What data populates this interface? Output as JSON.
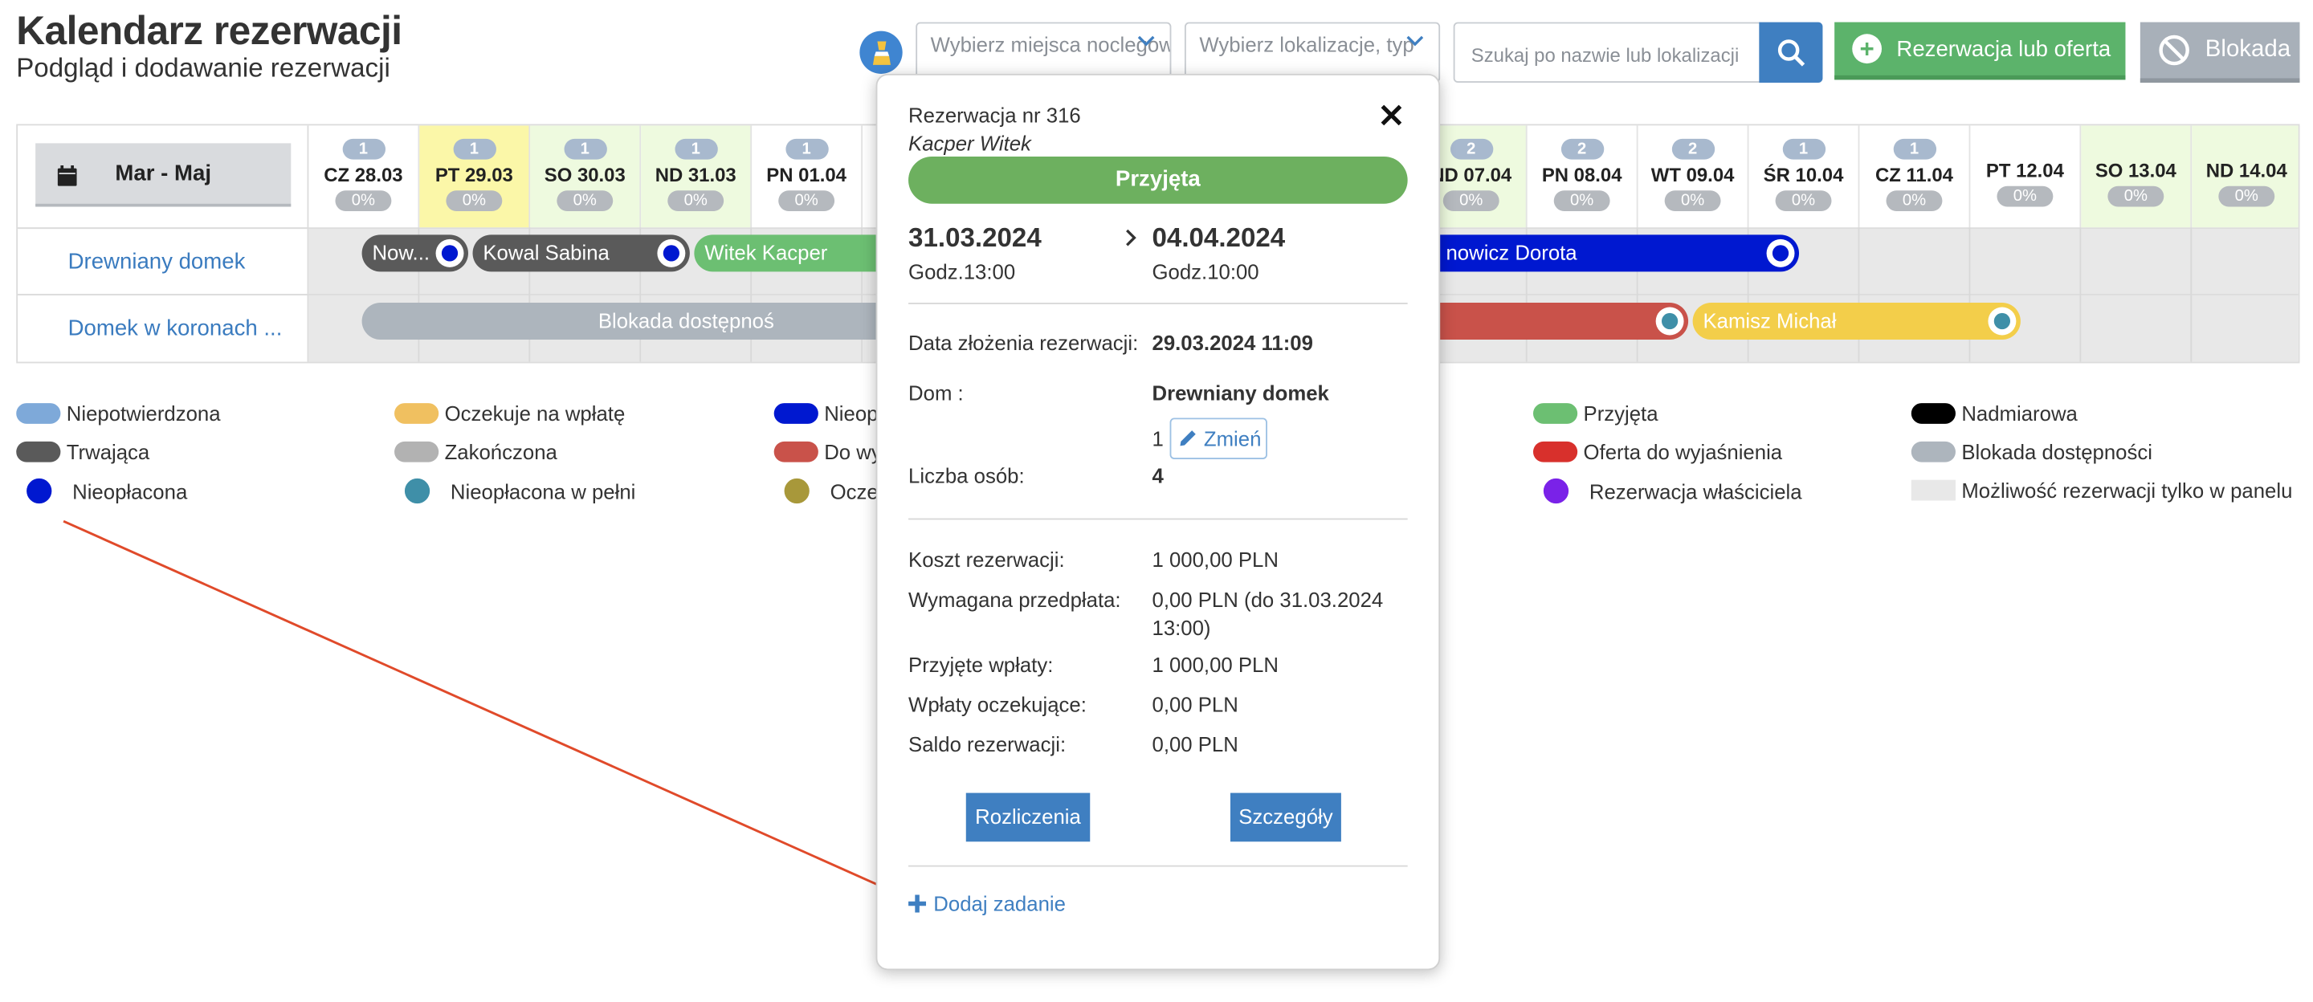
{
  "header": {
    "title": "Kalendarz rezerwacji",
    "subtitle": "Podgląd i dodawanie rezerwacji"
  },
  "toolbar": {
    "select_places_placeholder": "Wybierz miejsca noclegowe",
    "select_location_placeholder": "Wybierz lokalizacje, typ",
    "search_placeholder": "Szukaj po nazwie lub lokalizacji",
    "new_reservation_label": "Rezerwacja lub oferta",
    "block_label": "Blokada"
  },
  "calendar": {
    "range_label": "Mar - Maj",
    "days": [
      {
        "count": "1",
        "label": "CZ 28.03",
        "pct": "0%"
      },
      {
        "count": "1",
        "label": "PT 29.03",
        "pct": "0%",
        "bg": "#fbf7a8"
      },
      {
        "count": "1",
        "label": "SO 30.03",
        "pct": "0%",
        "bg": "#eefadf"
      },
      {
        "count": "1",
        "label": "ND 31.03",
        "pct": "0%",
        "bg": "#eefadf"
      },
      {
        "count": "1",
        "label": "PN 01.04",
        "pct": "0%"
      },
      {
        "count": "2",
        "label": "ND 07.04",
        "pct": "0%",
        "bg": "#eefadf"
      },
      {
        "count": "2",
        "label": "PN 08.04",
        "pct": "0%"
      },
      {
        "count": "2",
        "label": "WT 09.04",
        "pct": "0%"
      },
      {
        "count": "1",
        "label": "ŚR 10.04",
        "pct": "0%"
      },
      {
        "count": "1",
        "label": "CZ 11.04",
        "pct": "0%"
      },
      {
        "count": "",
        "label": "PT 12.04",
        "pct": "0%"
      },
      {
        "count": "",
        "label": "SO 13.04",
        "pct": "0%",
        "bg": "#eefadf"
      },
      {
        "count": "",
        "label": "ND 14.04",
        "pct": "0%",
        "bg": "#eefadf"
      }
    ],
    "rooms": [
      "Drewniany domek",
      "Domek w koronach ..."
    ],
    "bars": {
      "nowak": "Now...",
      "kowal": "Kowal Sabina",
      "witek": "Witek Kacper",
      "dorota": "nowicz Dorota",
      "blokada": "Blokada dostępnoś",
      "kamisz": "Kamisz Michał"
    }
  },
  "legend": [
    {
      "label": "Niepotwierdzona",
      "color": "#7ea9d9",
      "kind": "pill"
    },
    {
      "label": "Oczekuje na wpłatę",
      "color": "#f0c060",
      "kind": "pill"
    },
    {
      "label": "Nieop",
      "color": "#0018d0",
      "kind": "pill"
    },
    {
      "label": "Przyjęta",
      "color": "#6cbf72",
      "kind": "pill"
    },
    {
      "label": "Nadmiarowa",
      "color": "#000000",
      "kind": "pill"
    },
    {
      "label": "Trwająca",
      "color": "#5a5a5a",
      "kind": "pill"
    },
    {
      "label": "Zakończona",
      "color": "#b2b2b2",
      "kind": "pill"
    },
    {
      "label": "Do wy",
      "color": "#c9524a",
      "kind": "pill"
    },
    {
      "label": "Oferta do wyjaśnienia",
      "color": "#d8302c",
      "kind": "pill"
    },
    {
      "label": "Blokada dostępności",
      "color": "#adb5bd",
      "kind": "pill"
    },
    {
      "label": "Nieopłacona",
      "color": "#0018d0",
      "kind": "dot"
    },
    {
      "label": "Nieopłacona w pełni",
      "color": "#3f8fa8",
      "kind": "dot"
    },
    {
      "label": "Oczel",
      "color": "#a8983a",
      "kind": "dot"
    },
    {
      "label": "Rezerwacja właściciela",
      "color": "#7a22e8",
      "kind": "dot"
    },
    {
      "label": "Możliwość rezerwacji tylko w panelu",
      "color": "#e8e8e8",
      "kind": "square"
    }
  ],
  "popup": {
    "reservation_no": "Rezerwacja nr 316",
    "guest": "Kacper Witek",
    "status": "Przyjęta",
    "date_from": "31.03.2024",
    "time_from": "Godz.13:00",
    "date_to": "04.04.2024",
    "time_to": "Godz.10:00",
    "submitted_label": "Data złożenia rezerwacji:",
    "submitted_value": "29.03.2024 11:09",
    "house_label": "Dom :",
    "house_value": "Drewniany domek",
    "unit_value": "1",
    "change_label": "Zmień",
    "persons_label": "Liczba osób:",
    "persons_value": "4",
    "cost_label": "Koszt rezerwacji:",
    "cost_value": "1 000,00 PLN",
    "prepay_label": "Wymagana przedpłata:",
    "prepay_value_line1": "0,00 PLN (do 31.03.2024",
    "prepay_value_line2": "13:00)",
    "received_label": "Przyjęte wpłaty:",
    "received_value": "1 000,00 PLN",
    "pending_label": "Wpłaty oczekujące:",
    "pending_value": "0,00 PLN",
    "balance_label": "Saldo rezerwacji:",
    "balance_value": "0,00 PLN",
    "settlements_label": "Rozliczenia",
    "details_label": "Szczegóły",
    "add_task_label": "Dodaj zadanie"
  },
  "colors": {
    "accent": "#3f7fc1",
    "green": "#5cb36b",
    "arrow": "#e04a2a"
  }
}
